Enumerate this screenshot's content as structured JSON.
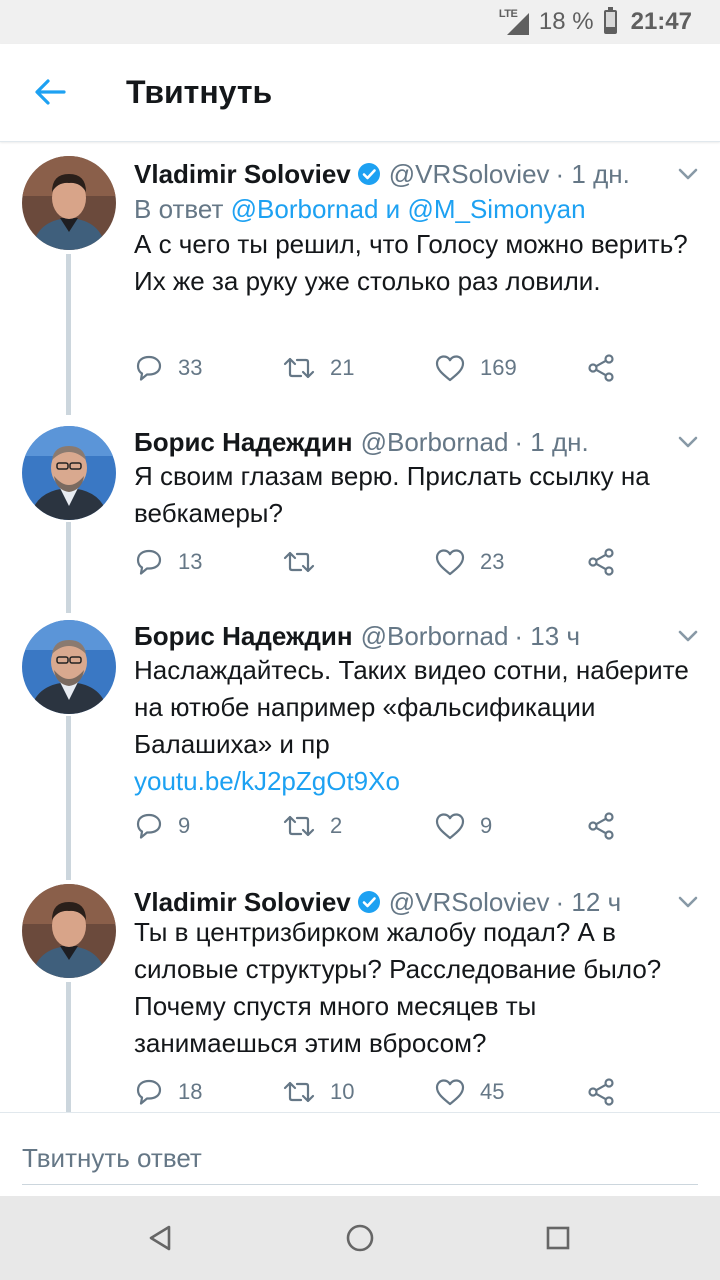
{
  "status_bar": {
    "network": "LTE",
    "battery": "18 %",
    "time": "21:47"
  },
  "header": {
    "title": "Твитнуть"
  },
  "tweets": [
    {
      "author": "Vladimir Soloviev",
      "verified": true,
      "handle": "@VRSoloviev",
      "time": "· 1 дн.",
      "reply_to": {
        "prefix": "В ответ",
        "user1": "@Borbornad",
        "joiner": "и",
        "user2": "@M_Simonyan"
      },
      "text": "А с чего ты решил, что Голосу можно верить? Их же за руку уже столько раз ловили.",
      "replies": "33",
      "retweets": "21",
      "likes": "169"
    },
    {
      "author": "Борис Надеждин",
      "verified": false,
      "handle": "@Borbornad",
      "time": "· 1 дн.",
      "text": "Я своим глазам верю. Прислать ссылку на вебкамеры?",
      "replies": "13",
      "retweets": "",
      "likes": "23"
    },
    {
      "author": "Борис Надеждин",
      "verified": false,
      "handle": "@Borbornad",
      "time": "· 13 ч",
      "text": "Наслаждайтесь. Таких видео сотни, наберите на ютюбе например «фальсификации Балашиха» и пр",
      "link": "youtu.be/kJ2pZgOt9Xo",
      "replies": "9",
      "retweets": "2",
      "likes": "9"
    },
    {
      "author": "Vladimir Soloviev",
      "verified": true,
      "handle": "@VRSoloviev",
      "time": "· 12 ч",
      "text": "Ты в центризбирком жалобу подал? А в силовые структуры? Расследование было? Почему спустя много месяцев ты занимаешься этим вбросом?",
      "replies": "18",
      "retweets": "10",
      "likes": "45"
    }
  ],
  "reply_bar": {
    "placeholder": "Твитнуть ответ"
  },
  "colors": {
    "accent": "#1da1f2",
    "meta": "#657786",
    "text": "#14171a",
    "thread_line": "#ccd6dd"
  }
}
